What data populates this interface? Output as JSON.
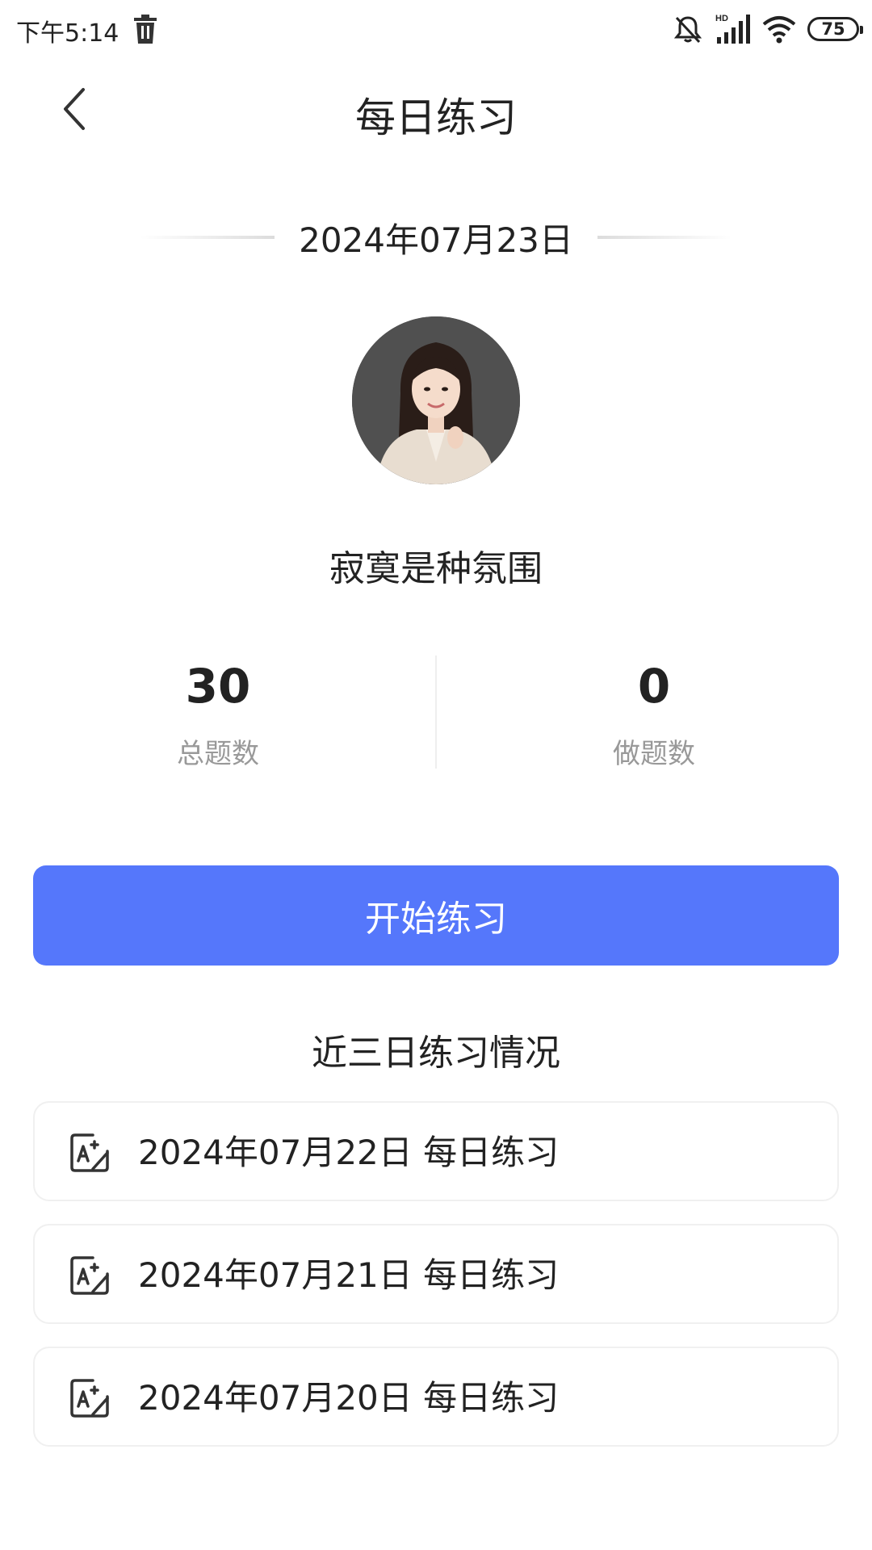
{
  "status_bar": {
    "time": "下午5:14",
    "battery": "75",
    "icons": [
      "trash-icon",
      "mute-icon",
      "signal-icon",
      "wifi-icon",
      "battery-icon"
    ]
  },
  "header": {
    "title": "每日练习",
    "back_icon": "chevron-left-icon"
  },
  "date": "2024年07月23日",
  "profile": {
    "name": "寂寞是种氛围"
  },
  "stats": {
    "total": {
      "value": "30",
      "label": "总题数"
    },
    "done": {
      "value": "0",
      "label": "做题数"
    }
  },
  "start_button": {
    "label": "开始练习",
    "color": "#5577fb"
  },
  "history": {
    "title": "近三日练习情况",
    "items": [
      {
        "label": "2024年07月22日 每日练习",
        "icon": "ai-edit-icon"
      },
      {
        "label": "2024年07月21日 每日练习",
        "icon": "ai-edit-icon"
      },
      {
        "label": "2024年07月20日 每日练习",
        "icon": "ai-edit-icon"
      }
    ]
  }
}
